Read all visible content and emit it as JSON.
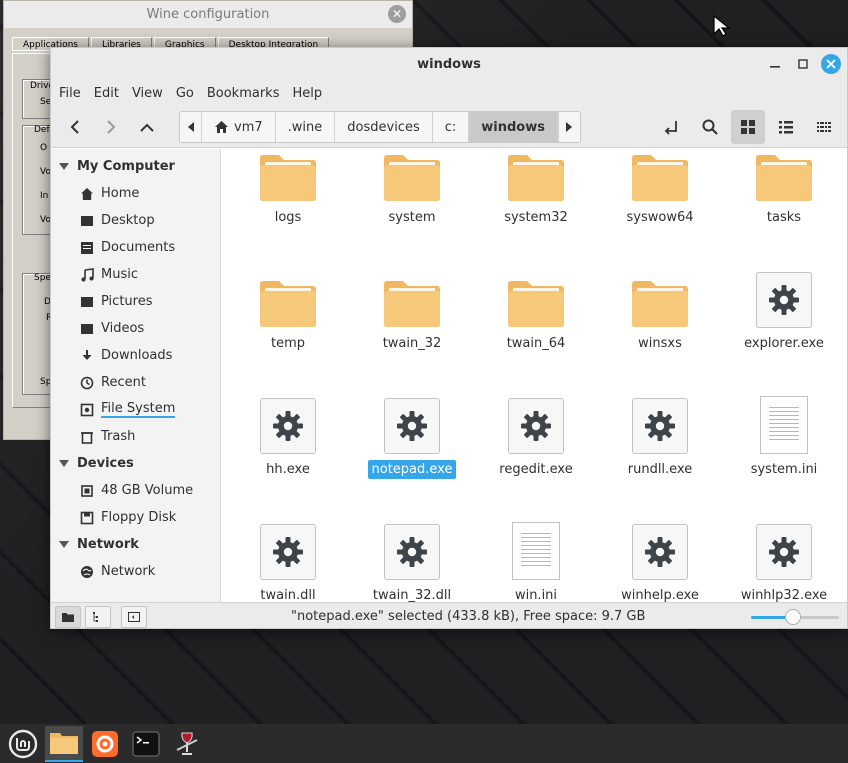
{
  "wine": {
    "title": "Wine configuration",
    "tabs": [
      "Applications",
      "Libraries",
      "Graphics",
      "Desktop Integration"
    ],
    "fragments": [
      "Drive",
      "Se",
      "Def",
      "O",
      "Vo",
      "In",
      "Vo",
      "Spe",
      "D",
      "R",
      "Sp"
    ]
  },
  "window": {
    "title": "windows",
    "minimize_icon": "minimize-icon",
    "maximize_icon": "maximize-icon",
    "close_icon": "close-icon"
  },
  "menu": [
    "File",
    "Edit",
    "View",
    "Go",
    "Bookmarks",
    "Help"
  ],
  "path": [
    {
      "label": "vm7",
      "home": true
    },
    {
      "label": ".wine"
    },
    {
      "label": "dosdevices"
    },
    {
      "label": "c:"
    },
    {
      "label": "windows",
      "active": true
    }
  ],
  "sidebar": {
    "sections": [
      {
        "title": "My Computer",
        "items": [
          {
            "label": "Home",
            "icon": "home-icon"
          },
          {
            "label": "Desktop",
            "icon": "desktop-icon"
          },
          {
            "label": "Documents",
            "icon": "documents-icon"
          },
          {
            "label": "Music",
            "icon": "music-icon"
          },
          {
            "label": "Pictures",
            "icon": "pictures-icon"
          },
          {
            "label": "Videos",
            "icon": "videos-icon"
          },
          {
            "label": "Downloads",
            "icon": "downloads-icon"
          },
          {
            "label": "Recent",
            "icon": "recent-icon"
          },
          {
            "label": "File System",
            "icon": "filesystem-icon",
            "underlined": true
          },
          {
            "label": "Trash",
            "icon": "trash-icon"
          }
        ]
      },
      {
        "title": "Devices",
        "items": [
          {
            "label": "48 GB Volume",
            "icon": "drive-icon"
          },
          {
            "label": "Floppy Disk",
            "icon": "floppy-icon"
          }
        ]
      },
      {
        "title": "Network",
        "items": [
          {
            "label": "Network",
            "icon": "network-icon"
          }
        ]
      }
    ]
  },
  "files": [
    {
      "name": "logs",
      "type": "folder"
    },
    {
      "name": "system",
      "type": "folder"
    },
    {
      "name": "system32",
      "type": "folder"
    },
    {
      "name": "syswow64",
      "type": "folder"
    },
    {
      "name": "tasks",
      "type": "folder"
    },
    {
      "name": "temp",
      "type": "folder"
    },
    {
      "name": "twain_32",
      "type": "folder"
    },
    {
      "name": "twain_64",
      "type": "folder"
    },
    {
      "name": "winsxs",
      "type": "folder"
    },
    {
      "name": "explorer.exe",
      "type": "exe"
    },
    {
      "name": "hh.exe",
      "type": "exe"
    },
    {
      "name": "notepad.exe",
      "type": "exe",
      "selected": true
    },
    {
      "name": "regedit.exe",
      "type": "exe"
    },
    {
      "name": "rundll.exe",
      "type": "exe"
    },
    {
      "name": "system.ini",
      "type": "text"
    },
    {
      "name": "twain.dll",
      "type": "exe"
    },
    {
      "name": "twain_32.dll",
      "type": "exe"
    },
    {
      "name": "win.ini",
      "type": "text"
    },
    {
      "name": "winhelp.exe",
      "type": "exe"
    },
    {
      "name": "winhlp32.exe",
      "type": "exe"
    }
  ],
  "status": {
    "text": "\"notepad.exe\" selected (433.8 kB), Free space: 9.7 GB",
    "zoom_fraction": 0.48
  },
  "taskbar": [
    "mint-menu-icon",
    "files-icon",
    "firefox-icon",
    "terminal-icon",
    "wine-icon"
  ],
  "colors": {
    "accent": "#35a7e8",
    "folder": "#f6c87a",
    "folder_tab": "#f2b861"
  }
}
